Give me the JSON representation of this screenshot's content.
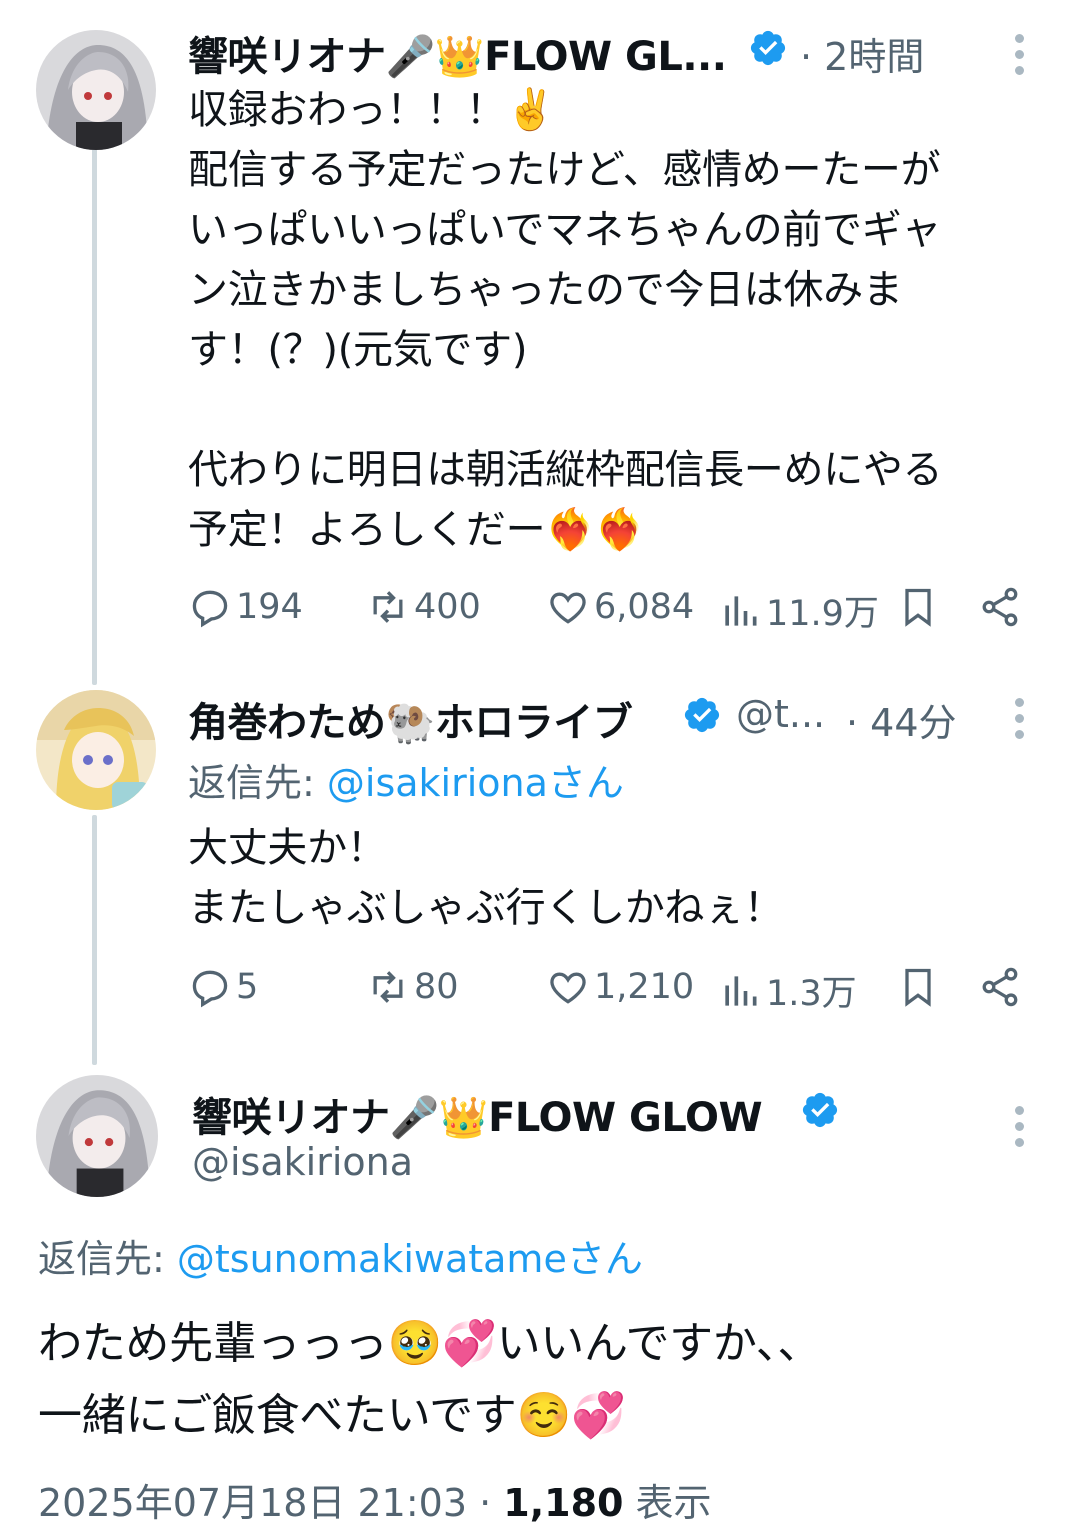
{
  "tweet1": {
    "display_name": "響咲リオナ🎤👑FLOW GL...",
    "time": "· 2時間",
    "text": "収録おわっ！！！✌️\n配信する予定だったけど、感情めーたーが\nいっぱいいっぱいでマネちゃんの前でギャ\nン泣きかましちゃったので今日は休みま\nす！(？)(元気です)\n\n代わりに明日は朝活縦枠配信長ーめにやる\n予定！よろしくだー❤️‍🔥❤️‍🔥",
    "replies": "194",
    "reposts": "400",
    "likes": "6,084",
    "views": "11.9万"
  },
  "tweet2": {
    "display_name": "角巻わため🐏ホロライブ",
    "handle": "@t...",
    "time": "· 44分",
    "reply_prefix": "返信先: ",
    "reply_to": "@isakirionaさん",
    "text": "大丈夫か！\nまたしゃぶしゃぶ行くしかねぇ！",
    "replies": "5",
    "reposts": "80",
    "likes": "1,210",
    "views": "1.3万"
  },
  "tweet3": {
    "display_name": "響咲リオナ🎤👑FLOW GLOW",
    "handle": "@isakiriona",
    "reply_prefix": "返信先: ",
    "reply_to": "@tsunomakiwatameさん",
    "text": "わため先輩っっっ🥹💞いいんですか、、\n一緒にご飯食べたいです☺️💞",
    "timestamp": "2025年07月18日 21:03 · ",
    "view_count": "1,180",
    "view_label": " 表示"
  },
  "colors": {
    "accent": "#1d9bf0",
    "secondary_text": "#536471",
    "thread_line": "#cfd9de"
  }
}
